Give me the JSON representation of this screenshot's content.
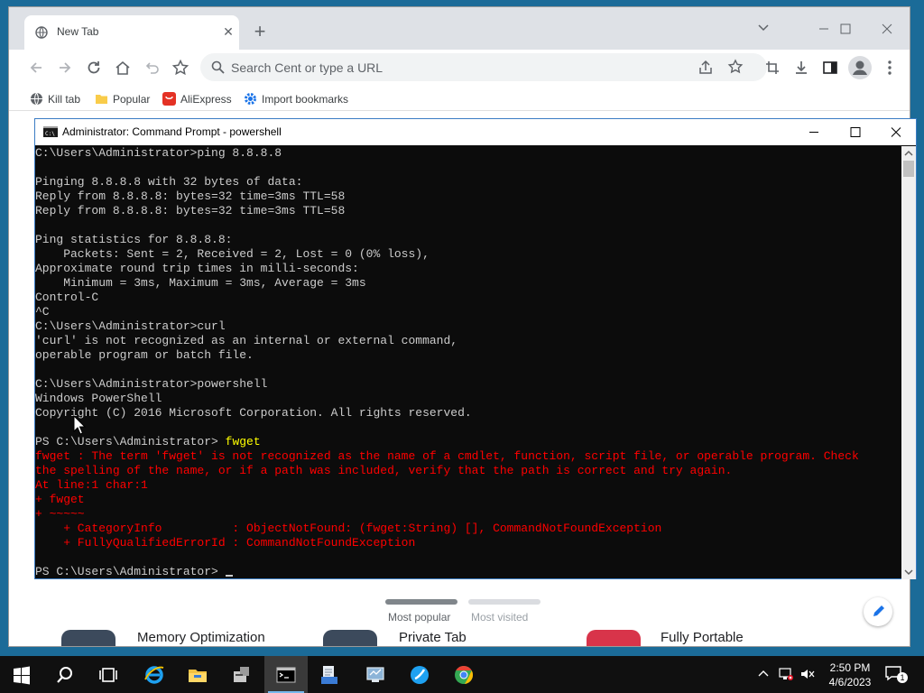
{
  "browser": {
    "tab": {
      "title": "New Tab"
    },
    "omnibox": {
      "placeholder": "Search Cent or type a URL"
    },
    "bookmarks": [
      {
        "label": "Kill tab",
        "icon": "globe-icon"
      },
      {
        "label": "Popular",
        "icon": "folder-icon"
      },
      {
        "label": "AliExpress",
        "icon": "aliexpress-icon"
      },
      {
        "label": "Import bookmarks",
        "icon": "gear-icon"
      }
    ],
    "ntp": {
      "tab_popular": "Most popular",
      "tab_visited": "Most visited",
      "tiles": [
        "Memory Optimization",
        "Private Tab",
        "Fully Portable"
      ]
    }
  },
  "cmd": {
    "title": "Administrator: Command Prompt - powershell",
    "lines": [
      {
        "text": "C:\\Users\\Administrator>ping 8.8.8.8",
        "style": "normal"
      },
      {
        "text": "",
        "style": "normal"
      },
      {
        "text": "Pinging 8.8.8.8 with 32 bytes of data:",
        "style": "normal"
      },
      {
        "text": "Reply from 8.8.8.8: bytes=32 time=3ms TTL=58",
        "style": "normal"
      },
      {
        "text": "Reply from 8.8.8.8: bytes=32 time=3ms TTL=58",
        "style": "normal"
      },
      {
        "text": "",
        "style": "normal"
      },
      {
        "text": "Ping statistics for 8.8.8.8:",
        "style": "normal"
      },
      {
        "text": "    Packets: Sent = 2, Received = 2, Lost = 0 (0% loss),",
        "style": "normal"
      },
      {
        "text": "Approximate round trip times in milli-seconds:",
        "style": "normal"
      },
      {
        "text": "    Minimum = 3ms, Maximum = 3ms, Average = 3ms",
        "style": "normal"
      },
      {
        "text": "Control-C",
        "style": "normal"
      },
      {
        "text": "^C",
        "style": "normal"
      },
      {
        "text": "C:\\Users\\Administrator>curl",
        "style": "normal"
      },
      {
        "text": "'curl' is not recognized as an internal or external command,",
        "style": "normal"
      },
      {
        "text": "operable program or batch file.",
        "style": "normal"
      },
      {
        "text": "",
        "style": "normal"
      },
      {
        "text": "C:\\Users\\Administrator>powershell",
        "style": "normal"
      },
      {
        "text": "Windows PowerShell",
        "style": "normal"
      },
      {
        "text": "Copyright (C) 2016 Microsoft Corporation. All rights reserved.",
        "style": "normal"
      },
      {
        "text": "",
        "style": "normal"
      },
      {
        "text": "PS C:\\Users\\Administrator> ",
        "style": "prompt",
        "command": "fwget"
      },
      {
        "text": "fwget : The term 'fwget' is not recognized as the name of a cmdlet, function, script file, or operable program. Check",
        "style": "error"
      },
      {
        "text": "the spelling of the name, or if a path was included, verify that the path is correct and try again.",
        "style": "error"
      },
      {
        "text": "At line:1 char:1",
        "style": "error"
      },
      {
        "text": "+ fwget",
        "style": "error"
      },
      {
        "text": "+ ~~~~~",
        "style": "error"
      },
      {
        "text": "    + CategoryInfo          : ObjectNotFound: (fwget:String) [], CommandNotFoundException",
        "style": "error"
      },
      {
        "text": "    + FullyQualifiedErrorId : CommandNotFoundException",
        "style": "error"
      },
      {
        "text": "",
        "style": "normal"
      },
      {
        "text": "PS C:\\Users\\Administrator> ",
        "style": "cursor"
      }
    ]
  },
  "taskbar": {
    "apps": [
      "start-icon",
      "search-icon",
      "task-view-icon",
      "internet-explorer-icon",
      "file-explorer-icon",
      "server-manager-icon",
      "command-prompt-icon",
      "notepad-files-icon",
      "network-icon",
      "cent-browser-icon",
      "chrome-icon"
    ],
    "time": "2:50 PM",
    "date": "4/6/2023",
    "notification_count": "1"
  },
  "colors": {
    "console_bg": "#0c0c0c",
    "console_text": "#cccccc",
    "error_text": "#ff0000",
    "command_text": "#ffff00",
    "taskbar_bg": "#101010"
  }
}
